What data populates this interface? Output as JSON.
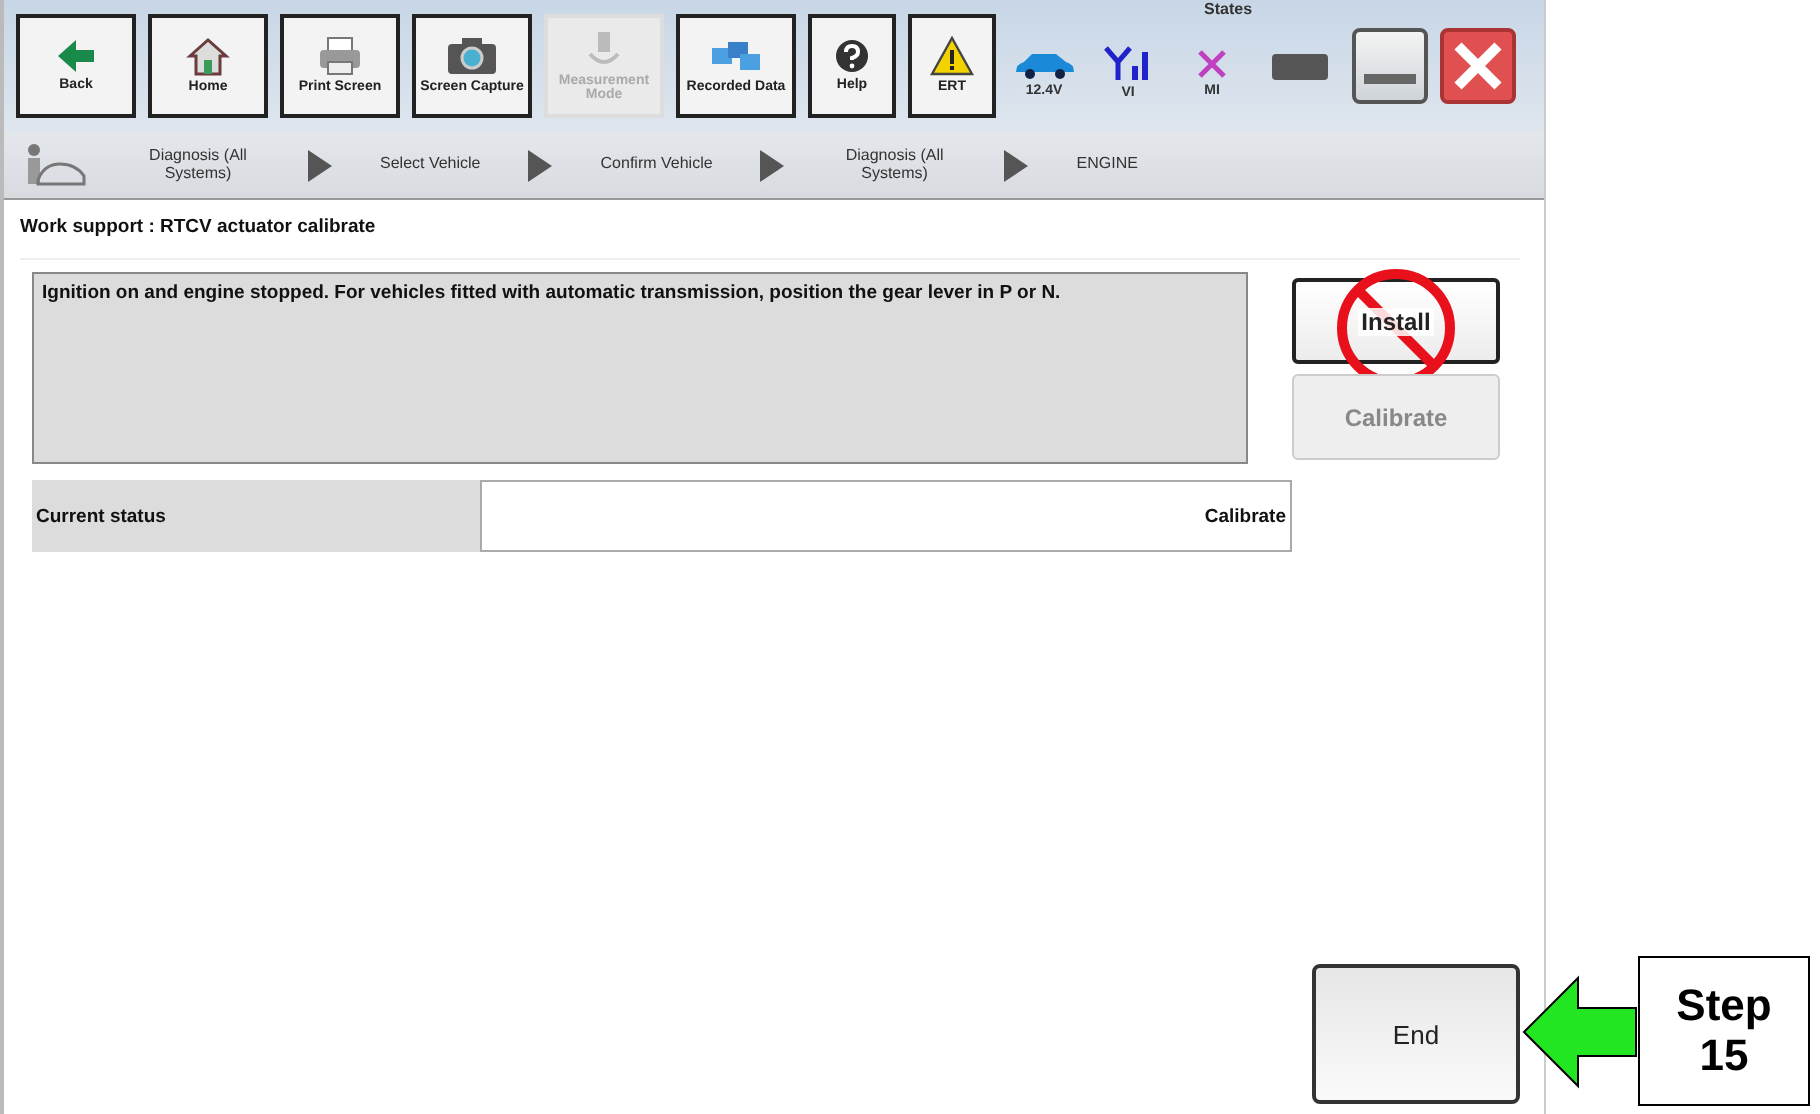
{
  "toolbar": {
    "buttons": [
      {
        "label": "Back",
        "disabled": false
      },
      {
        "label": "Home",
        "disabled": false
      },
      {
        "label": "Print Screen",
        "disabled": false
      },
      {
        "label": "Screen Capture",
        "disabled": false
      },
      {
        "label": "Measurement Mode",
        "disabled": true
      },
      {
        "label": "Recorded Data",
        "disabled": false
      },
      {
        "label": "Help",
        "disabled": false
      },
      {
        "label": "ERT",
        "disabled": false
      }
    ],
    "states_label": "States",
    "indicators": [
      {
        "label": "12.4V"
      },
      {
        "label": "VI"
      },
      {
        "label": "MI"
      }
    ]
  },
  "breadcrumb": [
    "Diagnosis (All Systems)",
    "Select Vehicle",
    "Confirm Vehicle",
    "Diagnosis (All Systems)",
    "ENGINE"
  ],
  "title": "Work support : RTCV actuator calibrate",
  "message": "Ignition on and engine stopped. For vehicles fitted with automatic transmission, position the gear lever in P or N.",
  "status_row": {
    "label": "Current status",
    "value": "Calibrate"
  },
  "actions": [
    {
      "label": "Install",
      "disabled": false,
      "prohibited": true
    },
    {
      "label": "Calibrate",
      "disabled": true,
      "prohibited": false
    }
  ],
  "end_button": {
    "label": "End"
  },
  "callout": {
    "text": "Step 15"
  }
}
